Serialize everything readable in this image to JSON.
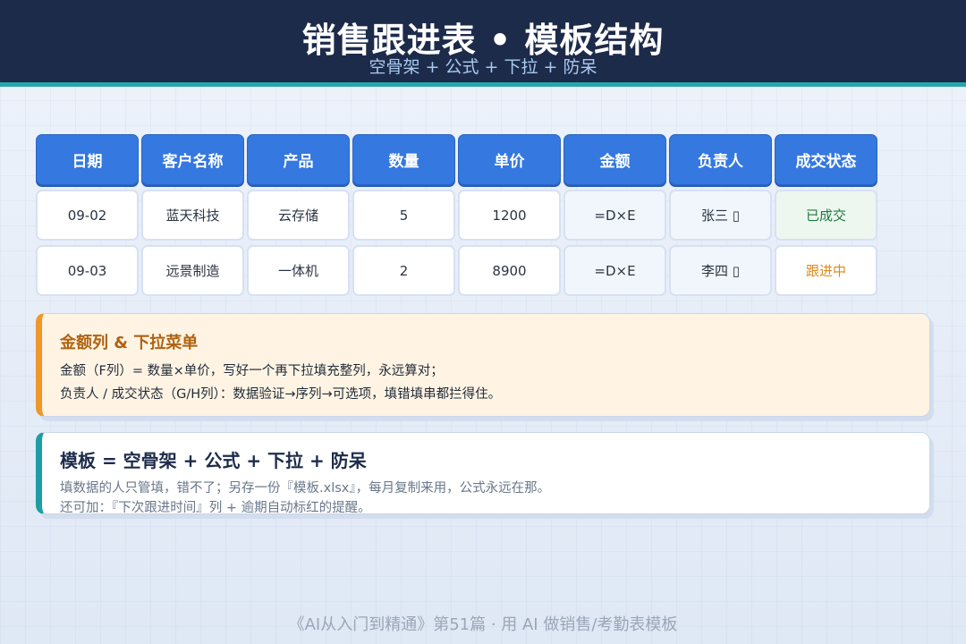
{
  "header": {
    "title": "销售跟进表 • 模板结构",
    "subtitle": "空骨架 + 公式 + 下拉 + 防呆"
  },
  "table": {
    "headers": [
      "日期",
      "客户名称",
      "产品",
      "数量",
      "单价",
      "金额",
      "负责人",
      "成交状态"
    ],
    "rows": [
      [
        "09-02",
        "蓝天科技",
        "云存储",
        "5",
        "1200",
        "=D×E",
        "张三 ▯",
        "已成交"
      ],
      [
        "09-03",
        "远景制造",
        "一体机",
        "2",
        "8900",
        "=D×E",
        "李四 ▯",
        "跟进中"
      ]
    ],
    "colors": {
      "header_bg": "#3478e0",
      "status_done": "#1e7a3a",
      "status_progress": "#dd8a1f"
    }
  },
  "note_dropdown": {
    "title": "金额列 & 下拉菜单",
    "line1": "金额（F列）= 数量×单价，写好一个再下拉填充整列，永远算对；",
    "line2": "负责人 / 成交状态（G/H列）：数据验证→序列→可选项，填错填串都拦得住。",
    "accent": "#f0962a"
  },
  "note_template": {
    "title": "模板 = 空骨架 + 公式 + 下拉 + 防呆",
    "line1": "填数据的人只管填，错不了；另存一份『模板.xlsx』，每月复制来用，公式永远在那。",
    "line2": "还可加：『下次跟进时间』列 + 逾期自动标红的提醒。",
    "accent": "#1c9ea4"
  },
  "footer": {
    "text": "《AI从入门到精通》第51篇 · 用 AI 做销售/考勤表模板"
  }
}
